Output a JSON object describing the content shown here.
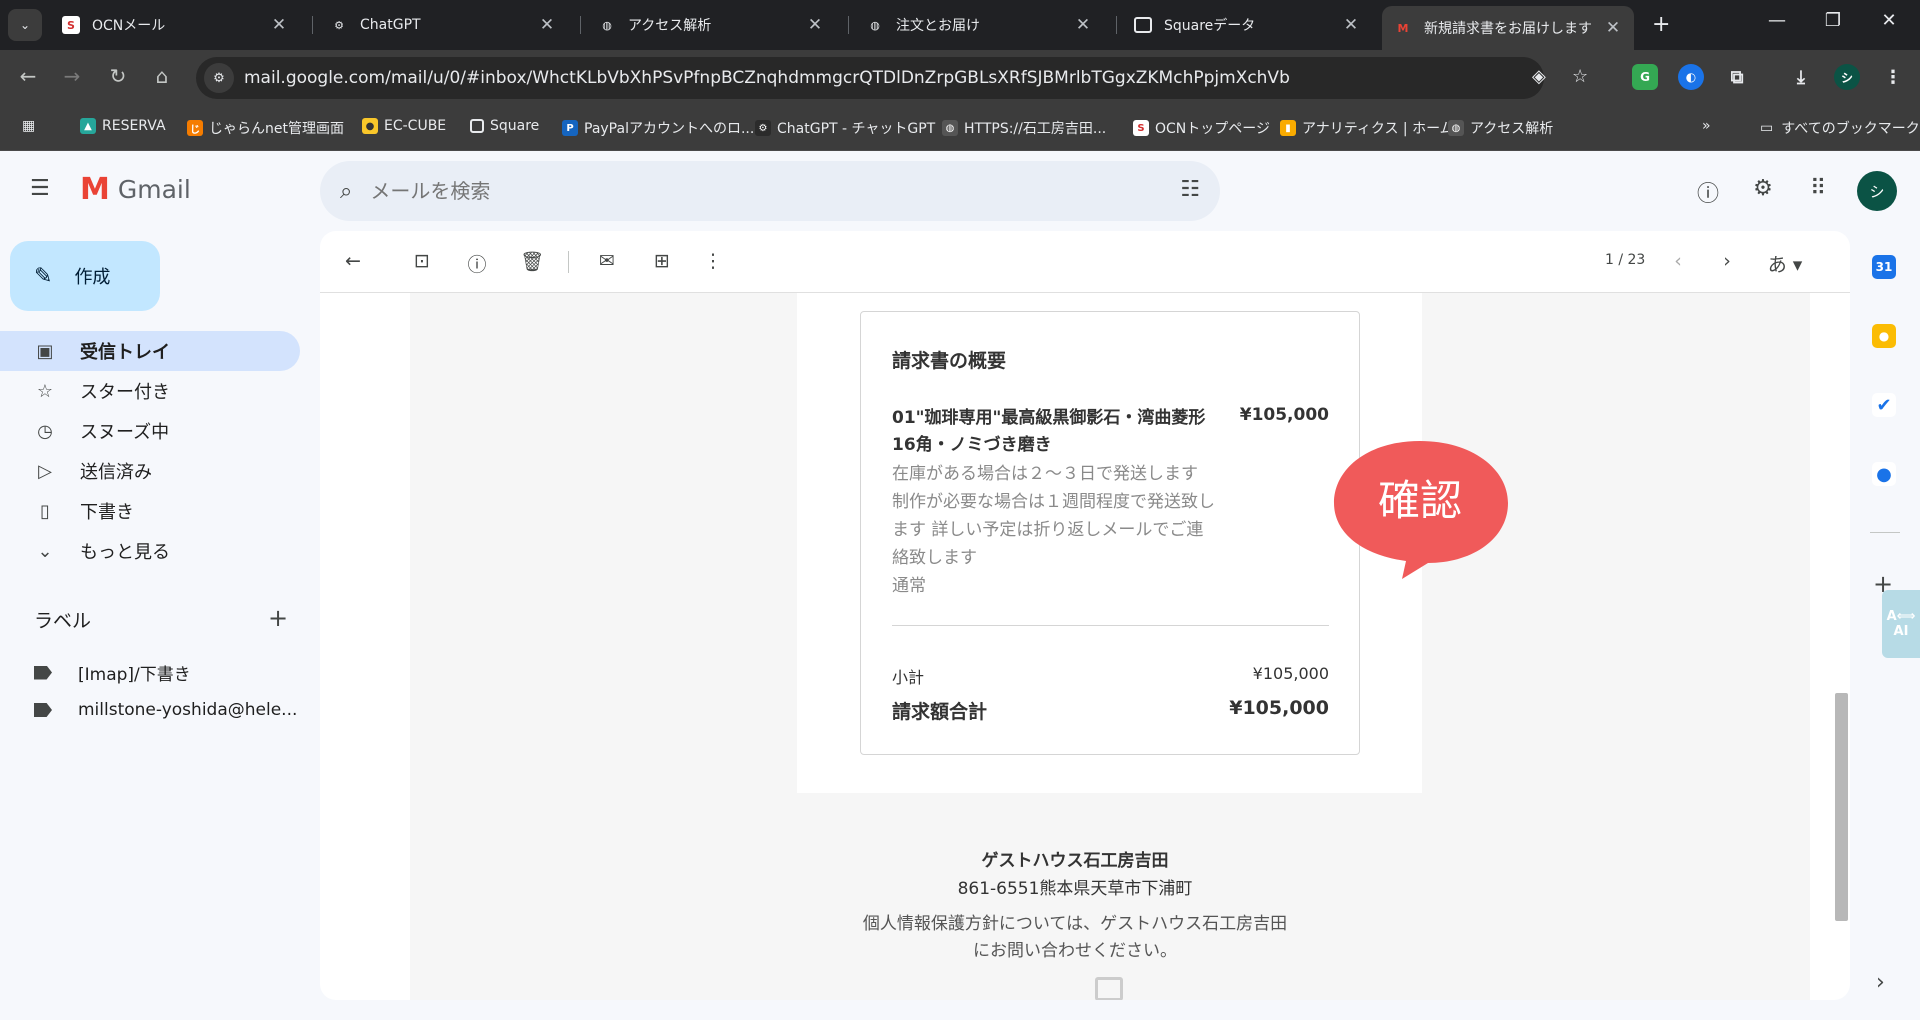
{
  "browser": {
    "tabs": [
      {
        "title": "OCNメール",
        "favicon": "ocn-icon"
      },
      {
        "title": "ChatGPT",
        "favicon": "chatgpt-icon"
      },
      {
        "title": "アクセス解析",
        "favicon": "globe-icon"
      },
      {
        "title": "注文とお届け",
        "favicon": "globe-icon"
      },
      {
        "title": "Squareデータ",
        "favicon": "square-icon"
      },
      {
        "title": "新規請求書をお届けします（",
        "favicon": "gmail-icon",
        "active": true
      }
    ],
    "url": "mail.google.com/mail/u/0/#inbox/WhctKLbVbXhPSvPfnpBCZnqhdmmgcrQTDlDnZrpGBLsXRfSJBMrlbTGgxZKMchPpjmXchVb",
    "bookmarks": [
      "RESERVA",
      "じゃらんnet管理画面",
      "EC-CUBE",
      "Square",
      "PayPalアカウントへのロ...",
      "ChatGPT - チャットGPT",
      "HTTPS://石工房吉田...",
      "OCNトップページ",
      "アナリティクス | ホーム",
      "アクセス解析"
    ],
    "all_bookmarks": "すべてのブックマーク",
    "profile_initial": "シ"
  },
  "gmail": {
    "logo": "Gmail",
    "search_placeholder": "メールを検索",
    "avatar_initial": "シ",
    "compose": "作成",
    "nav": [
      {
        "label": "受信トレイ",
        "icon": "inbox-icon"
      },
      {
        "label": "スター付き",
        "icon": "star-icon"
      },
      {
        "label": "スヌーズ中",
        "icon": "clock-icon"
      },
      {
        "label": "送信済み",
        "icon": "send-icon"
      },
      {
        "label": "下書き",
        "icon": "draft-icon"
      },
      {
        "label": "もっと見る",
        "icon": "chevron-down-icon"
      }
    ],
    "labels_title": "ラベル",
    "labels": [
      "[Imap]/下書き",
      "millstone-yoshida@hele..."
    ],
    "pager": "1 / 23",
    "input_tool": "あ"
  },
  "invoice": {
    "title": "請求書の概要",
    "item_name": "01\"珈琲専用\"最高級黒御影石・湾曲菱形16角・ノミづき磨き",
    "item_price": "¥105,000",
    "item_desc": "在庫がある場合は２～３日で発送します 制作が必要な場合は１週間程度で発送致します 詳しい予定は折り返しメールでご連絡致します",
    "item_option": "通常",
    "subtotal_label": "小計",
    "subtotal_value": "¥105,000",
    "total_label": "請求額合計",
    "total_value": "¥105,000"
  },
  "confirm_bubble": {
    "label": "確認",
    "color": "#f05a5a"
  },
  "footer": {
    "name": "ゲストハウス石工房吉田",
    "address": "861-6551熊本県天草市下浦町",
    "note": "個人情報保護方針については、ゲストハウス石工房吉田にお問い合わせください。"
  },
  "side_panel": {
    "ai_label": "AI"
  },
  "colors": {
    "accent": "#c2e7ff",
    "inbox_active": "#d3e3fd",
    "confirm": "#f05a5a"
  }
}
